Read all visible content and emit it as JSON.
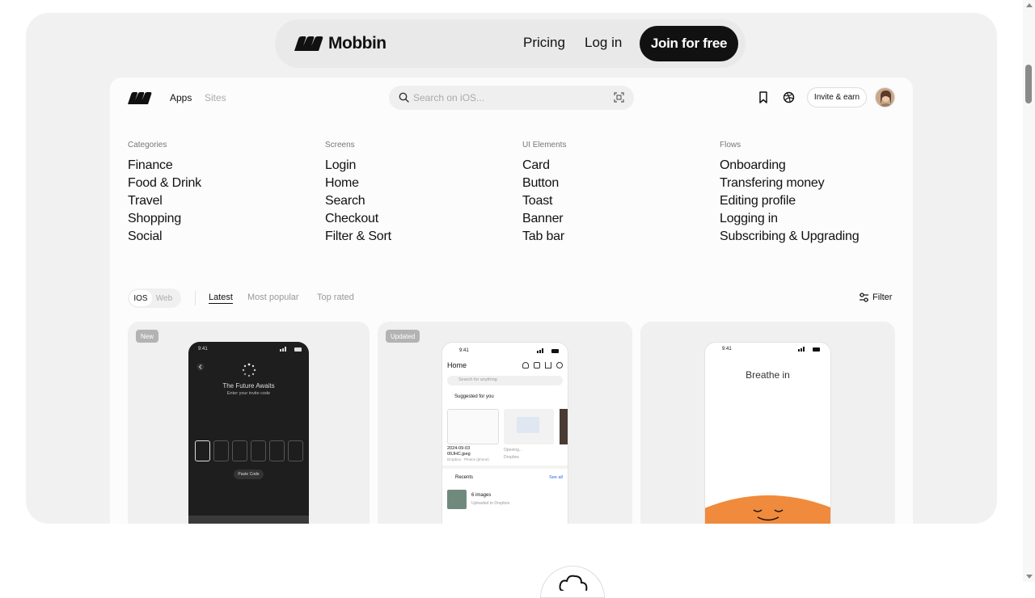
{
  "topnav": {
    "brand": "Mobbin",
    "pricing": "Pricing",
    "login": "Log in",
    "join": "Join for free"
  },
  "app": {
    "tabs": {
      "apps": "Apps",
      "sites": "Sites"
    },
    "search_placeholder": "Search on iOS...",
    "invite": "Invite & earn"
  },
  "columns": [
    {
      "head": "Categories",
      "items": [
        "Finance",
        "Food & Drink",
        "Travel",
        "Shopping",
        "Social"
      ]
    },
    {
      "head": "Screens",
      "items": [
        "Login",
        "Home",
        "Search",
        "Checkout",
        "Filter & Sort"
      ]
    },
    {
      "head": "UI Elements",
      "items": [
        "Card",
        "Button",
        "Toast",
        "Banner",
        "Tab bar"
      ]
    },
    {
      "head": "Flows",
      "items": [
        "Onboarding",
        "Transfering money",
        "Editing profile",
        "Logging in",
        "Subscribing & Upgrading"
      ]
    }
  ],
  "platform": {
    "ios": "IOS",
    "web": "Web"
  },
  "sort": {
    "latest": "Latest",
    "popular": "Most popular",
    "top": "Top rated"
  },
  "filter": "Filter",
  "cards": [
    {
      "badge": "New",
      "time": "9:41",
      "title": "The Future Awaits",
      "subtitle": "Enter your invite code",
      "paste": "Paste Code"
    },
    {
      "badge": "Updated",
      "time": "9:41",
      "title": "Home",
      "search": "Search for anything",
      "suggested": "Suggested for you",
      "file_date": "2024-09-03",
      "file_name": "00JHC.jpeg",
      "file_meta": "Dropbox · Photos (phone)",
      "opening": "Opening...",
      "opening_src": "Dropbox",
      "recents": "Recents",
      "see_all": "See all",
      "recent_title": "6 images",
      "recent_meta": "Uploaded to Dropbox"
    },
    {
      "badge": "",
      "time": "9:41",
      "title": "Breathe in"
    }
  ],
  "colors": {
    "accent_orange": "#f08a3c",
    "dark": "#111111"
  }
}
